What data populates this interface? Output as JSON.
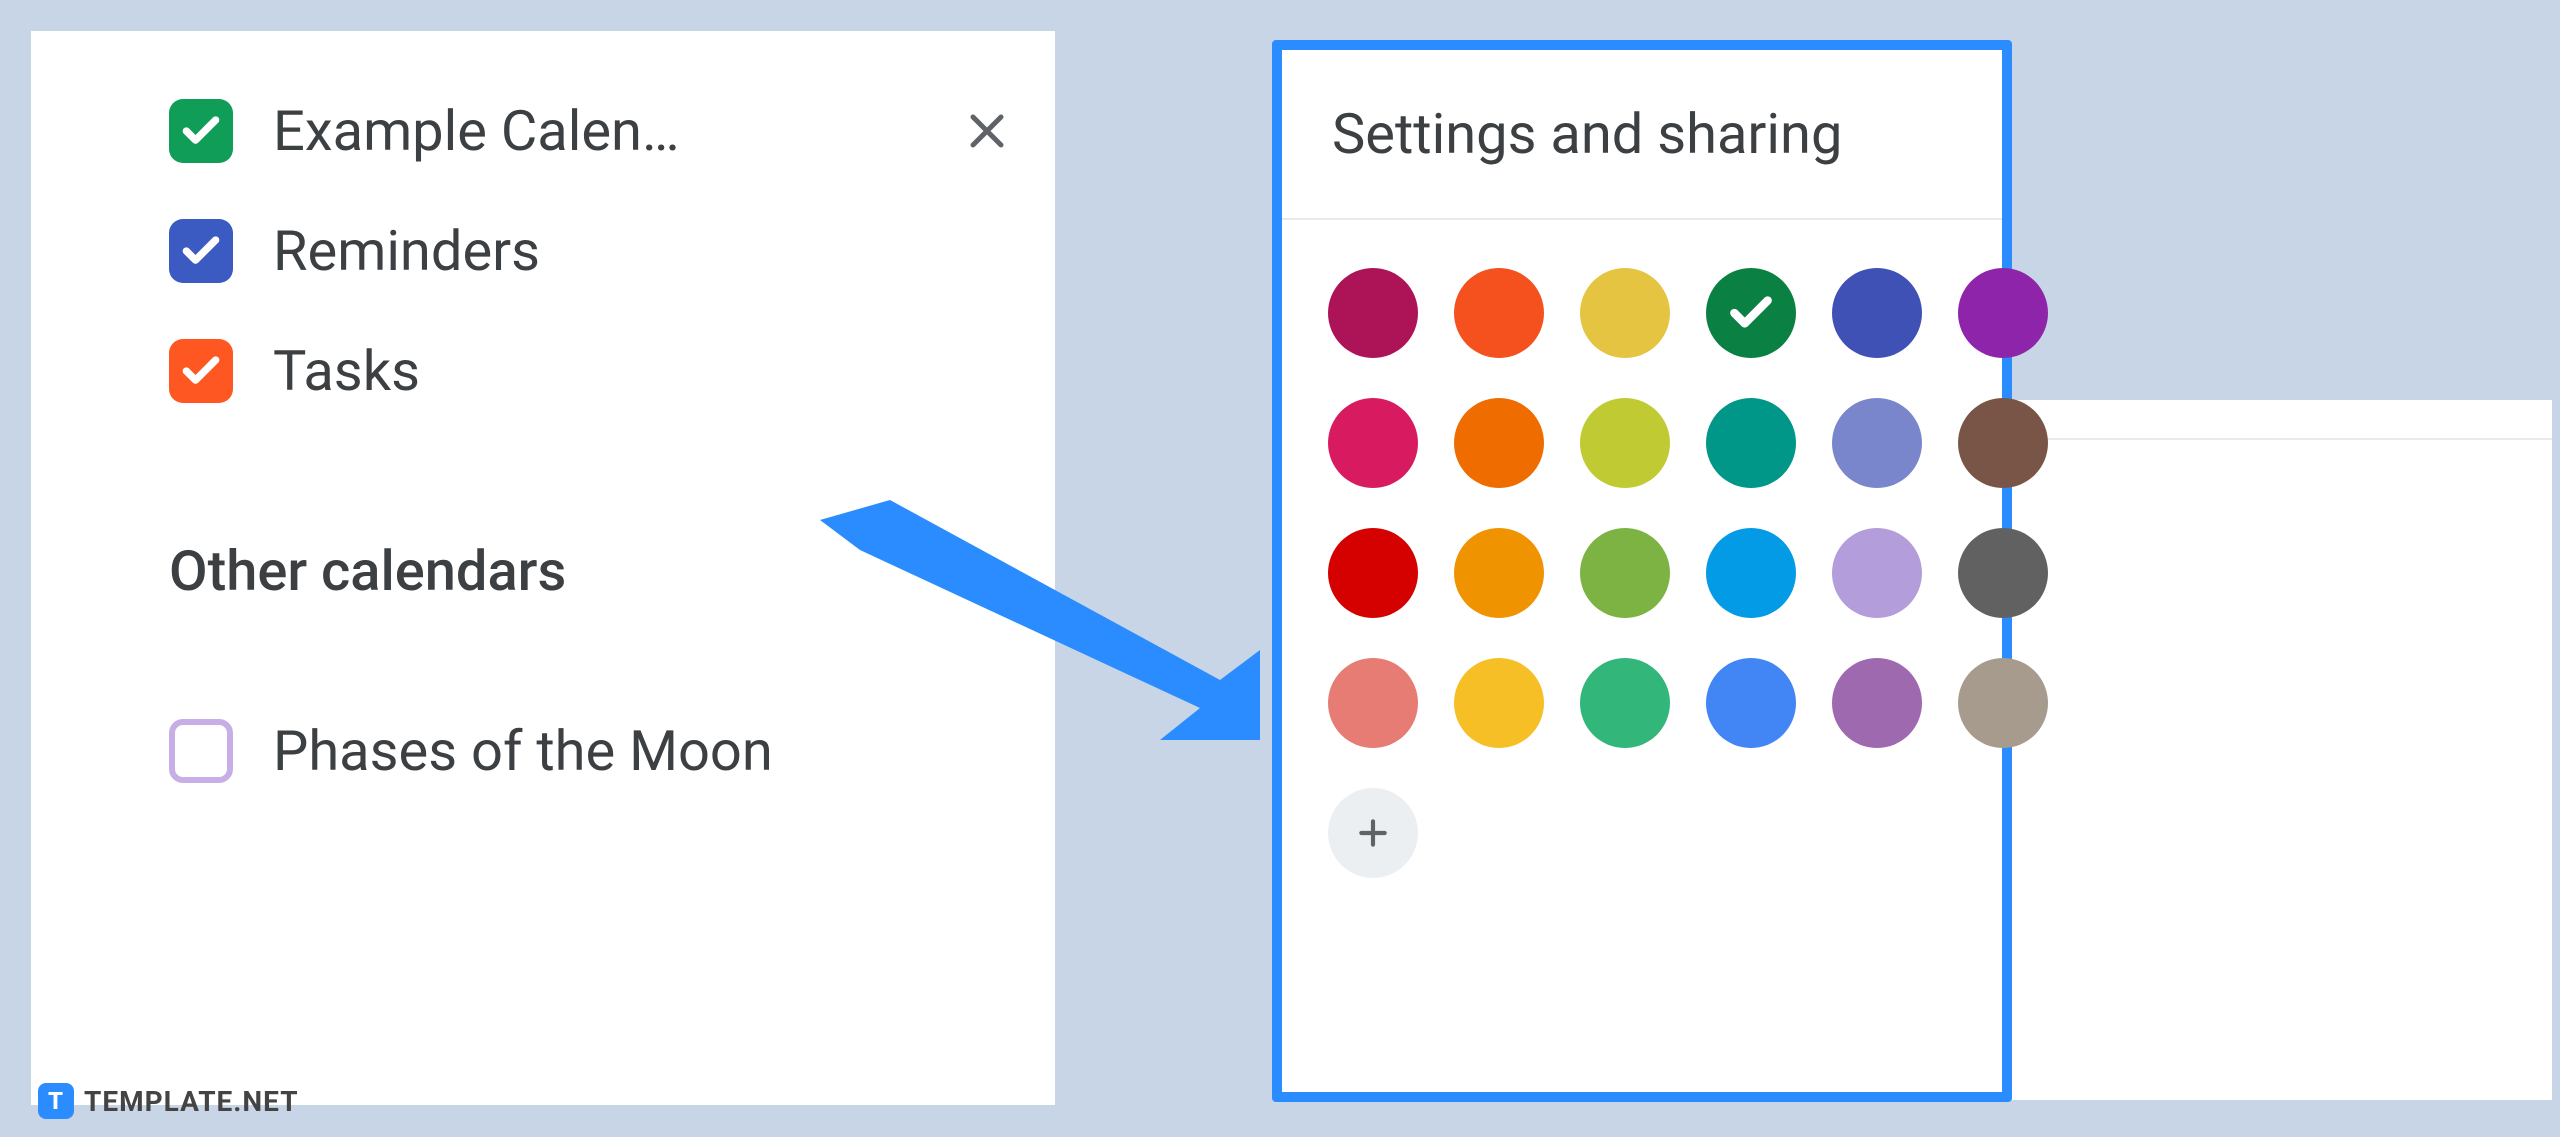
{
  "sidebar": {
    "calendars": [
      {
        "label": "Example Calen…",
        "color": "#0f9d58",
        "checked": true,
        "showClose": true
      },
      {
        "label": "Reminders",
        "color": "#3b5ac2",
        "checked": true,
        "showClose": false
      },
      {
        "label": "Tasks",
        "color": "#ff5722",
        "checked": true,
        "showClose": false
      }
    ],
    "otherHeader": "Other calendars",
    "otherCalendars": [
      {
        "label": "Phases of the Moon",
        "color": "#c8aee6",
        "checked": false
      }
    ]
  },
  "popup": {
    "title": "Settings and sharing",
    "selectedIndex": 3,
    "colors": [
      "#ad1457",
      "#f4511e",
      "#e4c441",
      "#0b8043",
      "#3f51b5",
      "#8e24aa",
      "#d81b60",
      "#ef6c00",
      "#c0ca33",
      "#009688",
      "#7986cb",
      "#795548",
      "#d50000",
      "#f09300",
      "#7cb342",
      "#039be5",
      "#b39ddb",
      "#616161",
      "#e67c73",
      "#f6bf26",
      "#33b679",
      "#4285f4",
      "#9e69af",
      "#a79b8e"
    ]
  },
  "watermark": {
    "badge": "T",
    "text": "TEMPLATE.NET"
  }
}
